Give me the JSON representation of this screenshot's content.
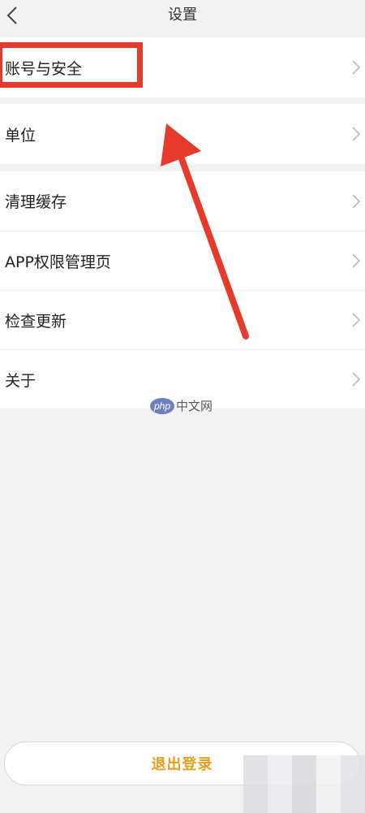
{
  "header": {
    "title": "设置",
    "back_icon": "chevron-left-icon"
  },
  "sections": [
    {
      "items": [
        {
          "label": "账号与安全",
          "icon": "chevron-right-icon",
          "highlighted": true
        }
      ]
    },
    {
      "items": [
        {
          "label": "单位",
          "icon": "chevron-right-icon"
        }
      ]
    },
    {
      "items": [
        {
          "label": "清理缓存",
          "icon": "chevron-right-icon"
        },
        {
          "label": "APP权限管理页",
          "icon": "chevron-right-icon"
        },
        {
          "label": "检查更新",
          "icon": "chevron-right-icon"
        },
        {
          "label": "关于",
          "icon": "chevron-right-icon"
        }
      ]
    }
  ],
  "watermark": {
    "logo_text": "php",
    "text": "中文网"
  },
  "logout": {
    "label": "退出登录"
  },
  "colors": {
    "highlight": "#e63a2a",
    "logout_text": "#e5a020",
    "background": "#f2f2f2"
  }
}
